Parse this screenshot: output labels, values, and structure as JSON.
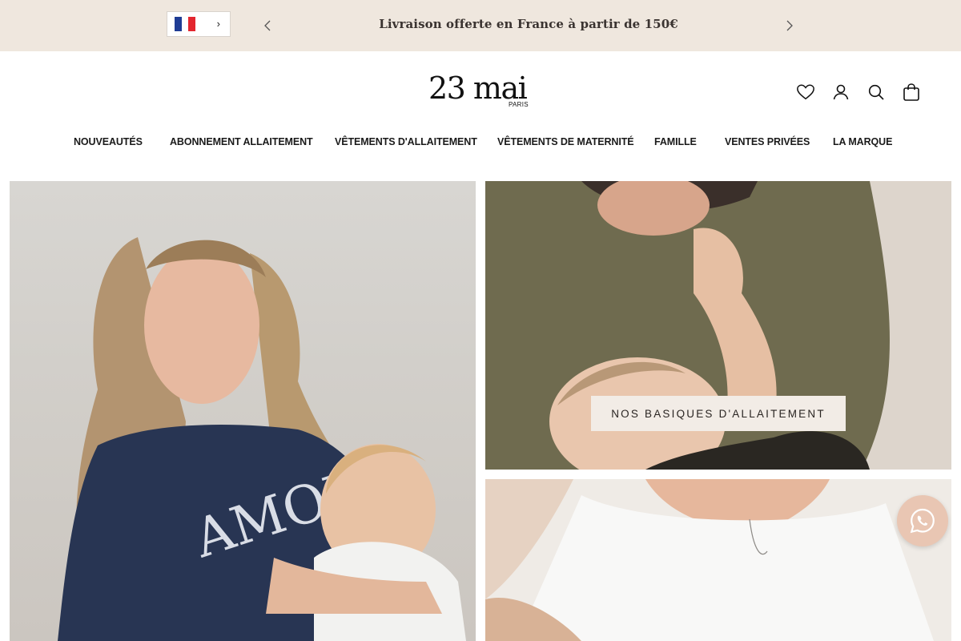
{
  "announcement": {
    "text": "Livraison offerte en France à partir de 150€",
    "background": "#efe7de"
  },
  "language_selector": {
    "flag": "france-flag-icon",
    "chevron": "›"
  },
  "logo": {
    "main": "23 mai",
    "sub": "PARIS"
  },
  "header_icons": [
    "wishlist-heart-icon",
    "account-icon",
    "search-icon",
    "cart-bag-icon"
  ],
  "nav": {
    "items": [
      "NOUVEAUTÉS",
      "ABONNEMENT ALLAITEMENT",
      "VÊTEMENTS D'ALLAITEMENT",
      "VÊTEMENTS DE MATERNITÉ",
      "FAMILLE",
      "VENTES PRIVÉES",
      "LA MARQUE"
    ]
  },
  "hero": {
    "cta_label": "NOS BASIQUES D'ALLAITEMENT",
    "cta_background": "#f2ece6"
  },
  "chat": {
    "icon": "whatsapp-icon",
    "color": "#e9c6b3"
  }
}
